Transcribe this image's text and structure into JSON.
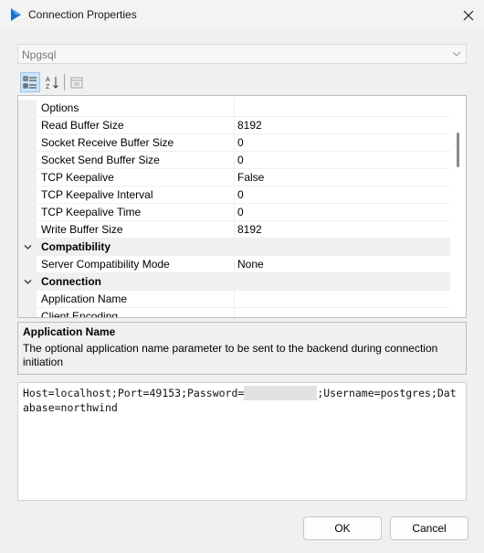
{
  "window": {
    "title": "Connection Properties"
  },
  "provider": {
    "value": "Npgsql"
  },
  "toolbar": {
    "categorized_icon": "categorized-view-icon",
    "alphabetical_icon": "alphabetical-sort-icon",
    "property_pages_icon": "property-pages-icon"
  },
  "grid": {
    "rows": [
      {
        "type": "prop",
        "name": "Options",
        "value": ""
      },
      {
        "type": "prop",
        "name": "Read Buffer Size",
        "value": "8192"
      },
      {
        "type": "prop",
        "name": "Socket Receive Buffer Size",
        "value": "0"
      },
      {
        "type": "prop",
        "name": "Socket Send Buffer Size",
        "value": "0"
      },
      {
        "type": "prop",
        "name": "TCP Keepalive",
        "value": "False"
      },
      {
        "type": "prop",
        "name": "TCP Keepalive Interval",
        "value": "0"
      },
      {
        "type": "prop",
        "name": "TCP Keepalive Time",
        "value": "0"
      },
      {
        "type": "prop",
        "name": "Write Buffer Size",
        "value": "8192"
      },
      {
        "type": "category",
        "name": "Compatibility"
      },
      {
        "type": "prop",
        "name": "Server Compatibility Mode",
        "value": "None"
      },
      {
        "type": "category",
        "name": "Connection"
      },
      {
        "type": "prop",
        "name": "Application Name",
        "value": ""
      },
      {
        "type": "prop",
        "name": "Client Encoding",
        "value": ""
      }
    ]
  },
  "help": {
    "title": "Application Name",
    "description": "The optional application name parameter to be sent to the backend during connection initiation"
  },
  "connection_string": {
    "before_password": "Host=localhost;Port=49153;Password=",
    "after_password": ";Username=postgres;Database=northwind"
  },
  "buttons": {
    "ok": "OK",
    "cancel": "Cancel"
  },
  "colors": {
    "accent": "#0f6cbd",
    "selection": "#cce4f7"
  }
}
